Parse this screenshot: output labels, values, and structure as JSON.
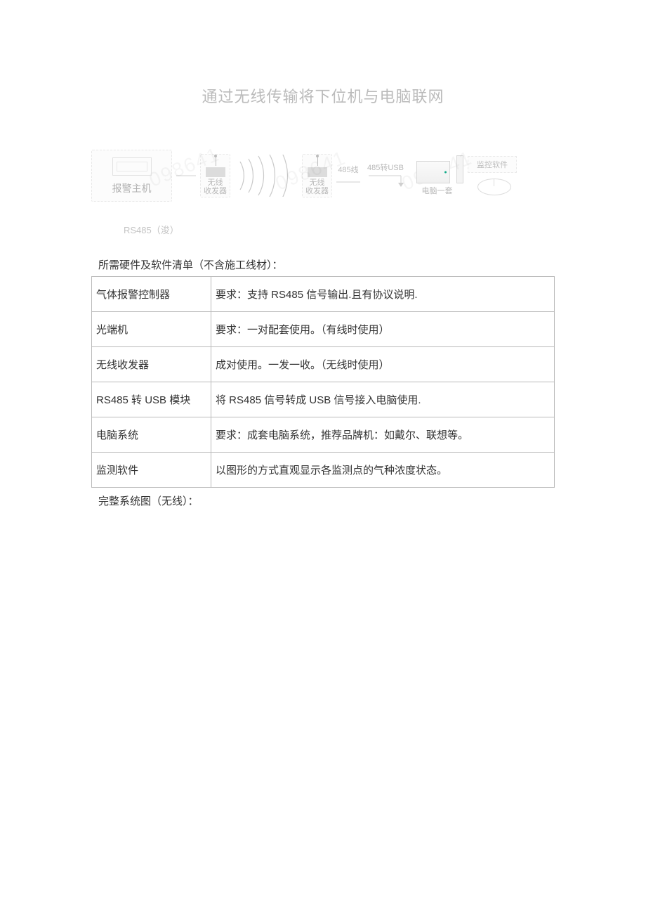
{
  "title": "通过无线传输将下位机与电脑联网",
  "diagram": {
    "alarm_host_label": "报警主机",
    "radio_label_line1": "无线",
    "radio_label_line2": "收发器",
    "converter_label": "485转USB",
    "bus_label": "485线",
    "pc_label": "电脑一套",
    "software_label": "监控软件",
    "rs485_note": "RS485（浚）"
  },
  "list_heading": "所需硬件及软件清单（不含施工线材）：",
  "table": [
    {
      "name": "气体报警控制器",
      "desc": "要求：支持 RS485 信号输出.且有协议说明."
    },
    {
      "name": "光端机",
      "desc": "要求：一对配套使用。（有线时使用）"
    },
    {
      "name": "无线收发器",
      "desc": "成对使用。一发一收。（无线时使用）"
    },
    {
      "name": "RS485 转 USB 模块",
      "desc": "将 RS485 信号转成 USB 信号接入电脑使用."
    },
    {
      "name": "电脑系统",
      "desc": "要求：成套电脑系统，推荐品牌机：如戴尔、联想等。"
    },
    {
      "name": "监测软件",
      "desc": "以图形的方式直观显示各监测点的气种浓度状态。"
    }
  ],
  "footer_label": "完整系统图（无线）："
}
